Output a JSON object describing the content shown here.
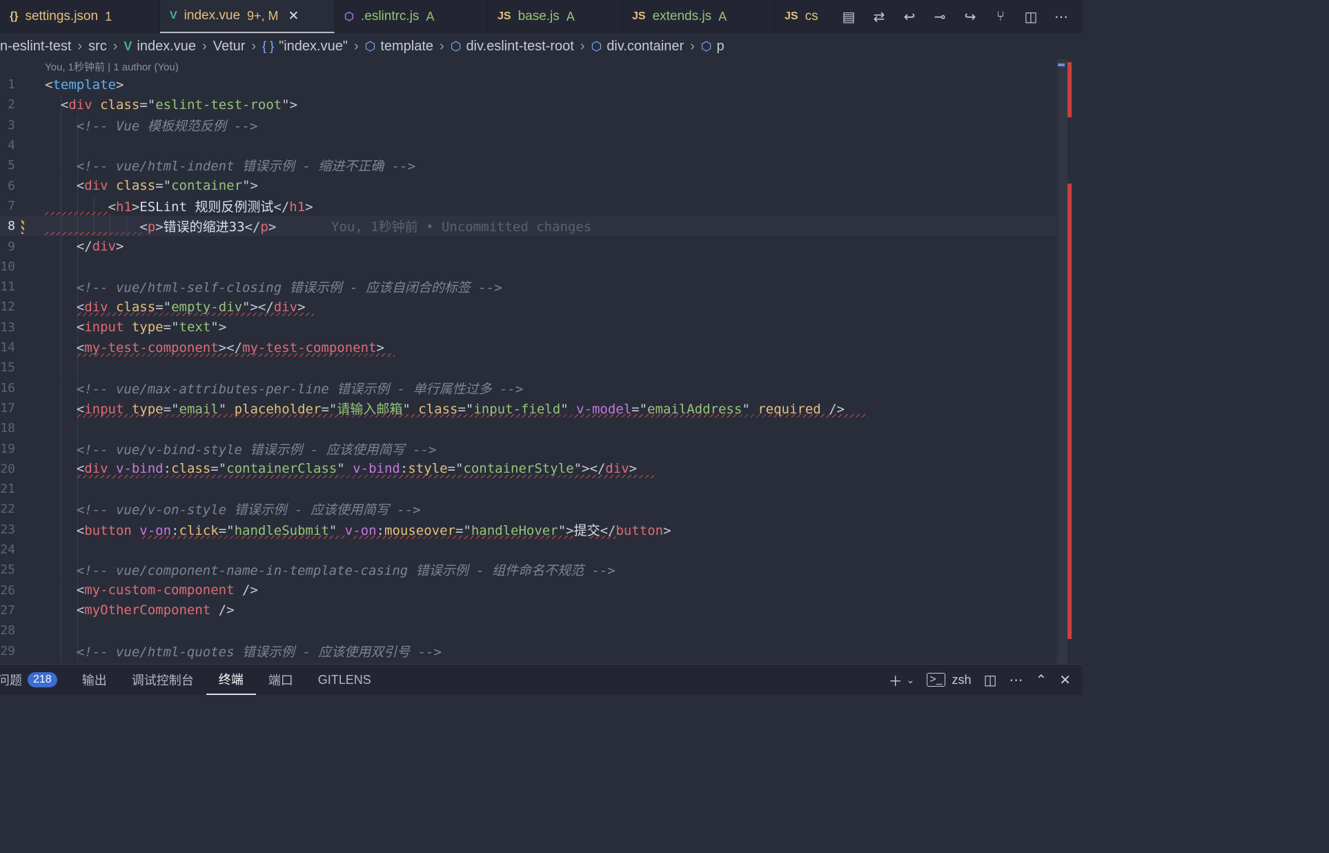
{
  "tabs": [
    {
      "icon": "{}",
      "name": "settings.json",
      "status": "1",
      "icon_color": "#e5c07b",
      "status_color": "#e5c07b",
      "name_color": "#e5c07b",
      "active": false
    },
    {
      "icon": "V",
      "name": "index.vue",
      "status": "9+, M",
      "icon_color": "#41b883",
      "status_color": "#e5c07b",
      "name_color": "#e5c07b",
      "active": true,
      "close": "✕"
    },
    {
      "icon": "⬡",
      "name": ".eslintrc.js",
      "status": "A",
      "icon_color": "#a070d0",
      "status_color": "#98c379",
      "name_color": "#98c379",
      "active": false
    },
    {
      "icon": "JS",
      "name": "base.js",
      "status": "A",
      "icon_color": "#e5c07b",
      "status_color": "#98c379",
      "name_color": "#98c379",
      "active": false
    },
    {
      "icon": "JS",
      "name": "extends.js",
      "status": "A",
      "icon_color": "#e5c07b",
      "status_color": "#98c379",
      "name_color": "#98c379",
      "active": false
    },
    {
      "icon": "JS",
      "name": "cs",
      "status": "",
      "icon_color": "#e5c07b",
      "status_color": "#98c379",
      "name_color": "#e5c07b",
      "active": false
    }
  ],
  "tab_actions": [
    "layout-icon",
    "compare-icon",
    "go-back-icon",
    "commit-icon",
    "go-forward-icon",
    "git-graph-icon",
    "split-editor-icon",
    "more-icon"
  ],
  "breadcrumb": [
    {
      "label": "n-eslint-test",
      "icon": ""
    },
    {
      "label": "src",
      "icon": ""
    },
    {
      "label": "index.vue",
      "icon": "vue"
    },
    {
      "label": "Vetur",
      "icon": ""
    },
    {
      "label": "\"index.vue\"",
      "icon": "braces"
    },
    {
      "label": "template",
      "icon": "cube"
    },
    {
      "label": "div.eslint-test-root",
      "icon": "cube"
    },
    {
      "label": "div.container",
      "icon": "cube"
    },
    {
      "label": "p",
      "icon": "cube"
    }
  ],
  "blame_header": "You, 1秒钟前 | 1 author (You)",
  "current_line_blame": "You, 1秒钟前 • Uncommitted changes",
  "lines": [
    [
      [
        "t-pun",
        "<"
      ],
      [
        "t-tpl",
        "template"
      ],
      [
        "t-pun",
        ">"
      ]
    ],
    [
      [
        "t-pun",
        "  <"
      ],
      [
        "t-tag",
        "div"
      ],
      [
        "t-pun",
        " "
      ],
      [
        "t-attr",
        "class"
      ],
      [
        "t-pun",
        "=\""
      ],
      [
        "t-str",
        "eslint-test-root"
      ],
      [
        "t-pun",
        "\">"
      ]
    ],
    [
      [
        "t-com",
        "    <!-- Vue 模板规范反例 -->"
      ]
    ],
    [],
    [
      [
        "t-com",
        "    <!-- vue/html-indent 错误示例 - 缩进不正确 -->"
      ]
    ],
    [
      [
        "t-pun",
        "    <"
      ],
      [
        "t-tag",
        "div"
      ],
      [
        "t-pun",
        " "
      ],
      [
        "t-attr",
        "class"
      ],
      [
        "t-pun",
        "=\""
      ],
      [
        "t-str",
        "container"
      ],
      [
        "t-pun",
        "\">"
      ]
    ],
    [
      [
        "t-pun",
        "        <"
      ],
      [
        "t-tag",
        "h1"
      ],
      [
        "t-pun",
        ">"
      ],
      [
        "t-txt",
        "ESLint 规则反例测试"
      ],
      [
        "t-pun",
        "</"
      ],
      [
        "t-tag",
        "h1"
      ],
      [
        "t-pun",
        ">"
      ]
    ],
    [
      [
        "t-pun",
        "            <"
      ],
      [
        "t-tag",
        "p"
      ],
      [
        "t-pun",
        ">"
      ],
      [
        "t-txt",
        "错误的缩进33"
      ],
      [
        "t-pun",
        "</"
      ],
      [
        "t-tag",
        "p"
      ],
      [
        "t-pun",
        ">"
      ]
    ],
    [
      [
        "t-pun",
        "    </"
      ],
      [
        "t-tag",
        "div"
      ],
      [
        "t-pun",
        ">"
      ]
    ],
    [],
    [
      [
        "t-com",
        "    <!-- vue/html-self-closing 错误示例 - 应该自闭合的标签 -->"
      ]
    ],
    [
      [
        "t-pun",
        "    <"
      ],
      [
        "t-tag",
        "div"
      ],
      [
        "t-pun",
        " "
      ],
      [
        "t-attr",
        "class"
      ],
      [
        "t-pun",
        "=\""
      ],
      [
        "t-str",
        "empty-div"
      ],
      [
        "t-pun",
        "\"></"
      ],
      [
        "t-tag",
        "div"
      ],
      [
        "t-pun",
        ">"
      ]
    ],
    [
      [
        "t-pun",
        "    <"
      ],
      [
        "t-tag",
        "input"
      ],
      [
        "t-pun",
        " "
      ],
      [
        "t-attr",
        "type"
      ],
      [
        "t-pun",
        "=\""
      ],
      [
        "t-str",
        "text"
      ],
      [
        "t-pun",
        "\">"
      ]
    ],
    [
      [
        "t-pun",
        "    <"
      ],
      [
        "t-tag",
        "my-test-component"
      ],
      [
        "t-pun",
        "></"
      ],
      [
        "t-tag",
        "my-test-component"
      ],
      [
        "t-pun",
        ">"
      ]
    ],
    [],
    [
      [
        "t-com",
        "    <!-- vue/max-attributes-per-line 错误示例 - 单行属性过多 -->"
      ]
    ],
    [
      [
        "t-pun",
        "    <"
      ],
      [
        "t-tag",
        "input"
      ],
      [
        "t-pun",
        " "
      ],
      [
        "t-attr",
        "type"
      ],
      [
        "t-pun",
        "=\""
      ],
      [
        "t-str",
        "email"
      ],
      [
        "t-pun",
        "\" "
      ],
      [
        "t-attr",
        "placeholder"
      ],
      [
        "t-pun",
        "=\""
      ],
      [
        "t-str",
        "请输入邮箱"
      ],
      [
        "t-pun",
        "\" "
      ],
      [
        "t-attr",
        "class"
      ],
      [
        "t-pun",
        "=\""
      ],
      [
        "t-str",
        "input-field"
      ],
      [
        "t-pun",
        "\" "
      ],
      [
        "t-dir",
        "v-model"
      ],
      [
        "t-pun",
        "=\""
      ],
      [
        "t-str",
        "emailAddress"
      ],
      [
        "t-pun",
        "\" "
      ],
      [
        "t-attr",
        "required"
      ],
      [
        "t-pun",
        " />"
      ]
    ],
    [],
    [
      [
        "t-com",
        "    <!-- vue/v-bind-style 错误示例 - 应该使用简写 -->"
      ]
    ],
    [
      [
        "t-pun",
        "    <"
      ],
      [
        "t-tag",
        "div"
      ],
      [
        "t-pun",
        " "
      ],
      [
        "t-dir",
        "v-bind"
      ],
      [
        "t-pun",
        ":"
      ],
      [
        "t-attr",
        "class"
      ],
      [
        "t-pun",
        "=\""
      ],
      [
        "t-str",
        "containerClass"
      ],
      [
        "t-pun",
        "\" "
      ],
      [
        "t-dir",
        "v-bind"
      ],
      [
        "t-pun",
        ":"
      ],
      [
        "t-attr",
        "style"
      ],
      [
        "t-pun",
        "=\""
      ],
      [
        "t-str",
        "containerStyle"
      ],
      [
        "t-pun",
        "\"></"
      ],
      [
        "t-tag",
        "div"
      ],
      [
        "t-pun",
        ">"
      ]
    ],
    [],
    [
      [
        "t-com",
        "    <!-- vue/v-on-style 错误示例 - 应该使用简写 -->"
      ]
    ],
    [
      [
        "t-pun",
        "    <"
      ],
      [
        "t-tag",
        "button"
      ],
      [
        "t-pun",
        " "
      ],
      [
        "t-dir",
        "v-on"
      ],
      [
        "t-pun",
        ":"
      ],
      [
        "t-attr",
        "click"
      ],
      [
        "t-pun",
        "=\""
      ],
      [
        "t-str",
        "handleSubmit"
      ],
      [
        "t-pun",
        "\" "
      ],
      [
        "t-dir",
        "v-on"
      ],
      [
        "t-pun",
        ":"
      ],
      [
        "t-attr",
        "mouseover"
      ],
      [
        "t-pun",
        "=\""
      ],
      [
        "t-str",
        "handleHover"
      ],
      [
        "t-pun",
        "\">"
      ],
      [
        "t-txt",
        "提交"
      ],
      [
        "t-pun",
        "</"
      ],
      [
        "t-tag",
        "button"
      ],
      [
        "t-pun",
        ">"
      ]
    ],
    [],
    [
      [
        "t-com",
        "    <!-- vue/component-name-in-template-casing 错误示例 - 组件命名不规范 -->"
      ]
    ],
    [
      [
        "t-pun",
        "    <"
      ],
      [
        "t-tag",
        "my-custom-component"
      ],
      [
        "t-pun",
        " />"
      ]
    ],
    [
      [
        "t-pun",
        "    <"
      ],
      [
        "t-tag",
        "myOtherComponent"
      ],
      [
        "t-pun",
        " />"
      ]
    ],
    [],
    [
      [
        "t-com",
        "    <!-- vue/html-quotes 错误示例 - 应该使用双引号 -->"
      ]
    ]
  ],
  "line_numbers": [
    "1",
    "2",
    "3",
    "4",
    "5",
    "6",
    "7",
    "8",
    "9",
    "10",
    "11",
    "12",
    "13",
    "14",
    "15",
    "16",
    "17",
    "18",
    "19",
    "20",
    "21",
    "22",
    "23",
    "24",
    "25",
    "26",
    "27",
    "28",
    "29"
  ],
  "current_line": 8,
  "panel": {
    "tabs": [
      {
        "label": "问题",
        "badge": "218",
        "active": false
      },
      {
        "label": "输出",
        "active": false
      },
      {
        "label": "调试控制台",
        "active": false
      },
      {
        "label": "终端",
        "active": true
      },
      {
        "label": "端口",
        "active": false
      },
      {
        "label": "GITLENS",
        "active": false
      }
    ],
    "terminal_name": "zsh"
  }
}
